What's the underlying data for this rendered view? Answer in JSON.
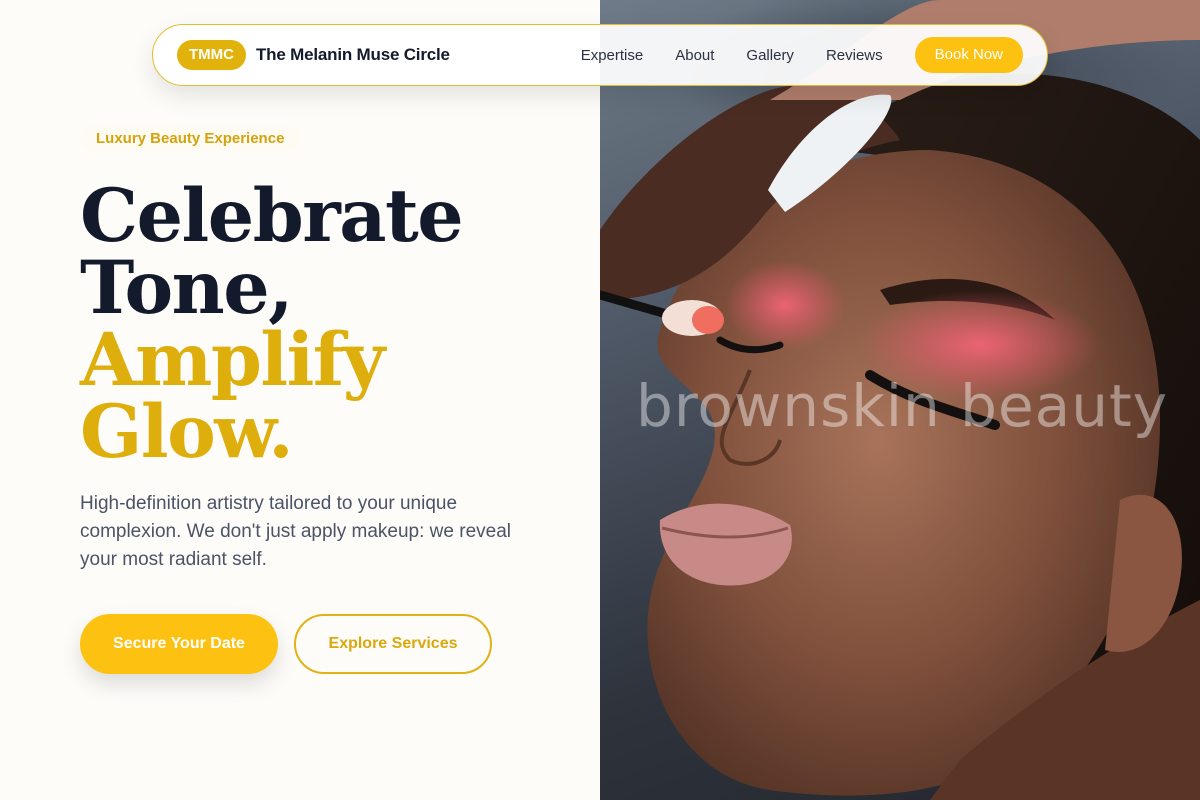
{
  "nav": {
    "badge": "TMMC",
    "brand_name": "The Melanin Muse Circle",
    "links": [
      {
        "label": "Expertise"
      },
      {
        "label": "About"
      },
      {
        "label": "Gallery"
      },
      {
        "label": "Reviews"
      }
    ],
    "cta_label": "Book Now"
  },
  "hero": {
    "tag": "Luxury Beauty Experience",
    "headline": {
      "line1": "Celebrate",
      "line2": "Tone,",
      "line3": "Amplify",
      "line4": "Glow."
    },
    "lead": "High-definition artistry tailored to your unique complexion. We don't just apply makeup: we reveal your most radiant self.",
    "primary_cta": "Secure Your Date",
    "secondary_cta": "Explore Services"
  },
  "photo": {
    "watermark": "brownskin beauty"
  },
  "colors": {
    "accent_gold": "#fcc111",
    "headline_gold": "#deae0c",
    "headline_dark": "#131a2c",
    "background": "#fdfcf9"
  }
}
